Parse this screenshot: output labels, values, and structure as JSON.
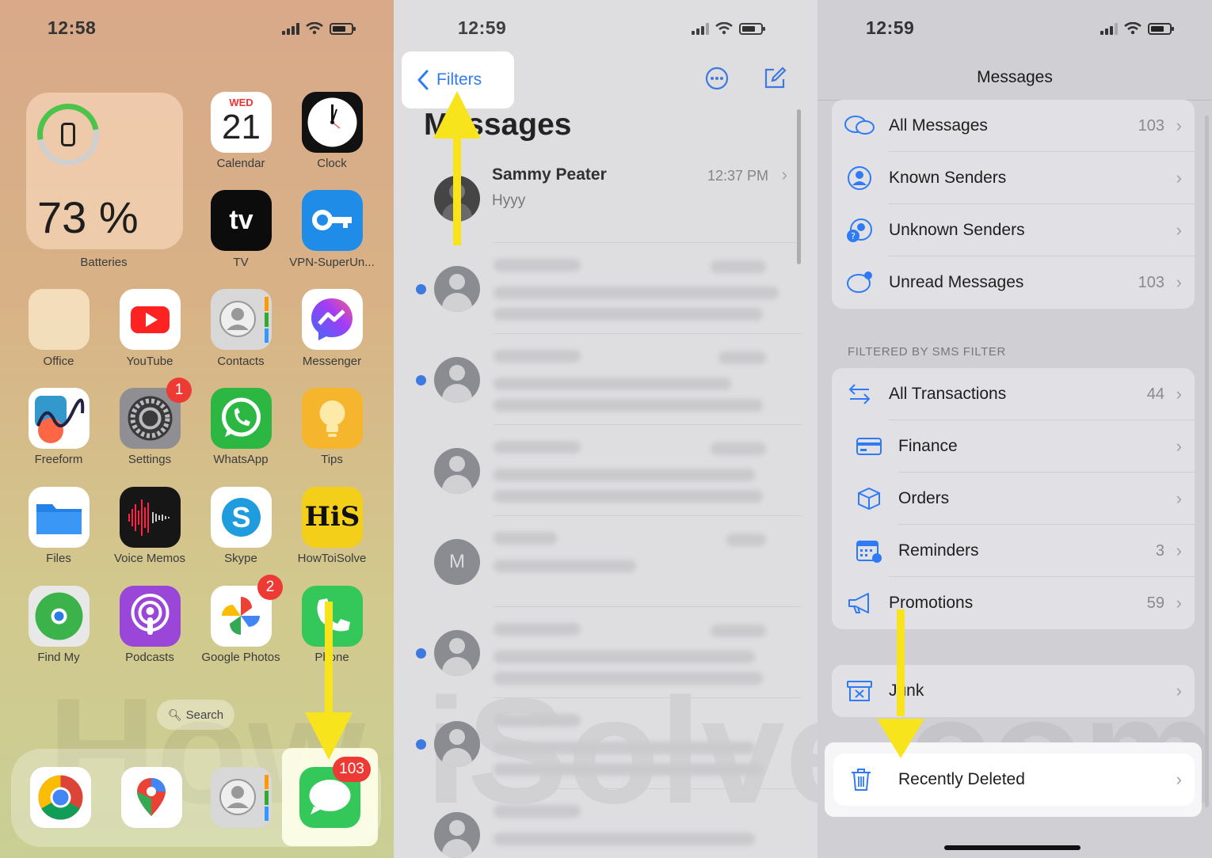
{
  "colors": {
    "accent": "#2f7bf6",
    "arrow": "#f7e41c",
    "badge": "#ee3a34"
  },
  "panel1": {
    "time": "12:58",
    "widget": {
      "percent": "73 %",
      "label": "Batteries",
      "level": 0.73
    },
    "calendar": {
      "weekday": "WED",
      "day": "21"
    },
    "apps": [
      {
        "label": "Calendar",
        "icon": "calendar-icon"
      },
      {
        "label": "Clock",
        "icon": "clock-icon"
      },
      {
        "label": "TV",
        "icon": "apple-tv-icon",
        "glyph": "tv"
      },
      {
        "label": "VPN-SuperUn...",
        "icon": "key-icon"
      },
      {
        "label": "Office",
        "icon": "folder-icon"
      },
      {
        "label": "YouTube",
        "icon": "youtube-icon"
      },
      {
        "label": "Contacts",
        "icon": "contacts-icon"
      },
      {
        "label": "Messenger",
        "icon": "messenger-icon"
      },
      {
        "label": "Freeform",
        "icon": "freeform-icon"
      },
      {
        "label": "Settings",
        "icon": "gear-icon",
        "badge": "1"
      },
      {
        "label": "WhatsApp",
        "icon": "whatsapp-icon"
      },
      {
        "label": "Tips",
        "icon": "lightbulb-icon"
      },
      {
        "label": "Files",
        "icon": "folder-icon"
      },
      {
        "label": "Voice Memos",
        "icon": "waveform-icon"
      },
      {
        "label": "Skype",
        "icon": "skype-icon",
        "glyph": "S"
      },
      {
        "label": "HowToiSolve",
        "icon": "howtoisolve-icon",
        "glyph": "HiS"
      },
      {
        "label": "Find My",
        "icon": "find-my-icon"
      },
      {
        "label": "Podcasts",
        "icon": "podcasts-icon"
      },
      {
        "label": "Google Photos",
        "icon": "pinwheel-icon",
        "badge": "2"
      },
      {
        "label": "Phone",
        "icon": "phone-icon"
      }
    ],
    "search_label": "Search",
    "dock": [
      {
        "icon": "chrome-icon"
      },
      {
        "icon": "google-maps-icon"
      },
      {
        "icon": "contacts-icon"
      },
      {
        "icon": "messages-icon",
        "badge": "103"
      }
    ]
  },
  "panel2": {
    "time": "12:59",
    "back_label": "Filters",
    "title": "Messages",
    "first": {
      "name": "Sammy Peater",
      "time": "12:37 PM",
      "preview": "Hyyy"
    },
    "other_initial": "M"
  },
  "panel3": {
    "time": "12:59",
    "nav_title": "Messages",
    "top_rows": [
      {
        "label": "All Messages",
        "count": "103",
        "icon": "chat-bubbles-icon"
      },
      {
        "label": "Known Senders",
        "count": "",
        "icon": "person-circle-icon"
      },
      {
        "label": "Unknown Senders",
        "count": "",
        "icon": "unknown-person-icon"
      },
      {
        "label": "Unread Messages",
        "count": "103",
        "icon": "unread-bubble-icon"
      }
    ],
    "section_header": "FILTERED BY SMS FILTER",
    "sms_rows": [
      {
        "label": "All Transactions",
        "count": "44",
        "icon": "arrows-swap-icon"
      },
      {
        "label": "Finance",
        "count": "",
        "icon": "credit-card-icon"
      },
      {
        "label": "Orders",
        "count": "",
        "icon": "box-icon"
      },
      {
        "label": "Reminders",
        "count": "3",
        "icon": "calendar-reminder-icon"
      },
      {
        "label": "Promotions",
        "count": "59",
        "icon": "megaphone-icon"
      }
    ],
    "junk": {
      "label": "Junk",
      "icon": "junk-box-icon"
    },
    "recently_deleted": {
      "label": "Recently Deleted",
      "icon": "trash-icon"
    }
  }
}
